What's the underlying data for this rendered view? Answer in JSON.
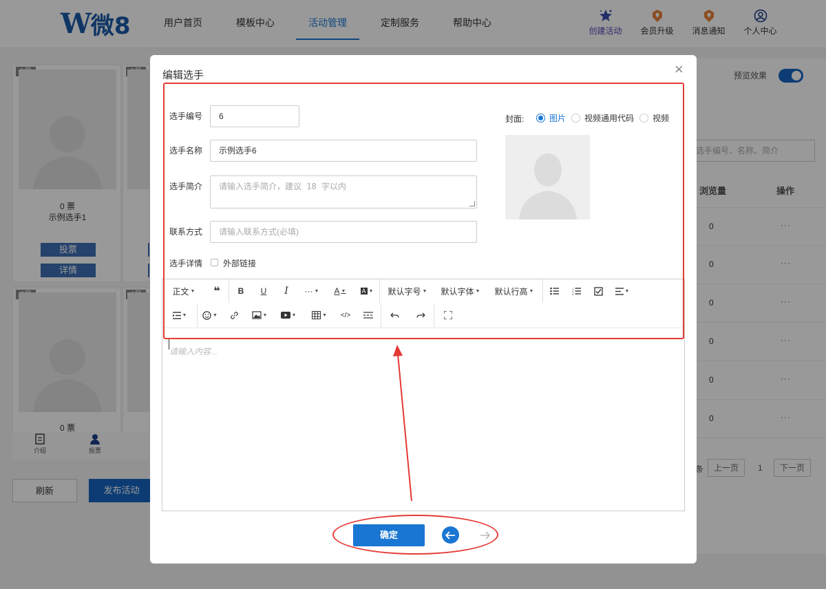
{
  "header": {
    "logo_mark": "W",
    "logo_text": "微8",
    "nav": [
      {
        "label": "用户首页"
      },
      {
        "label": "模板中心"
      },
      {
        "label": "活动管理"
      },
      {
        "label": "定制服务"
      },
      {
        "label": "帮助中心"
      }
    ],
    "actions": [
      {
        "label": "创建活动",
        "icon": "star-icon"
      },
      {
        "label": "会员升级",
        "icon": "badge-icon"
      },
      {
        "label": "消息通知",
        "icon": "bell-badge-icon"
      },
      {
        "label": "个人中心",
        "icon": "user-circle-icon"
      }
    ]
  },
  "background": {
    "cards": [
      {
        "num": "1号",
        "votes": "0 票",
        "name": "示例选手1",
        "vote_btn": "投票",
        "detail_btn": "详情"
      },
      {
        "num": "2号"
      },
      {
        "num": "3号",
        "votes": "0 票"
      },
      {
        "num": "4号"
      }
    ],
    "bottom_tabs": [
      {
        "label": "介绍",
        "icon": "doc-icon"
      },
      {
        "label": "投票",
        "icon": "person-icon"
      }
    ],
    "refresh_label": "刷新",
    "publish_label": "发布活动",
    "preview_label": "预览效果",
    "search_placeholder": "选手编号、名称、简介",
    "columns": {
      "views": "浏览量",
      "ops": "操作"
    },
    "rows": [
      {
        "views": "0",
        "ops": "···"
      },
      {
        "views": "0",
        "ops": "···"
      },
      {
        "views": "0",
        "ops": "···"
      },
      {
        "views": "0",
        "ops": "···"
      },
      {
        "views": "0",
        "ops": "···"
      },
      {
        "views": "0",
        "ops": "···"
      }
    ],
    "pager": {
      "total_tail": "条",
      "prev": "上一页",
      "page": "1",
      "next": "下一页"
    }
  },
  "modal": {
    "title": "编辑选手",
    "close": "×",
    "fields": {
      "number_label": "选手编号",
      "number_value": "6",
      "name_label": "选手名称",
      "name_value": "示例选手6",
      "intro_label": "选手简介",
      "intro_placeholder": "请输入选手简介，建议 18 字以内",
      "contact_label": "联系方式",
      "contact_placeholder": "请输入联系方式(必填)",
      "detail_label": "选手详情",
      "external_link_label": "外部链接"
    },
    "cover": {
      "label": "封面:",
      "options": [
        {
          "label": "图片",
          "selected": true
        },
        {
          "label": "视频通用代码",
          "selected": false
        },
        {
          "label": "视频",
          "selected": false
        }
      ]
    },
    "editor": {
      "toolbar_row1": [
        {
          "label": "正文",
          "dropdown": true,
          "icon": ""
        },
        {
          "label": "❝",
          "dropdown": false,
          "icon": "quote-icon"
        },
        {
          "label": "B",
          "dropdown": false,
          "icon": "bold-icon"
        },
        {
          "label": "U",
          "dropdown": false,
          "icon": "underline-icon"
        },
        {
          "label": "I",
          "dropdown": false,
          "icon": "italic-icon"
        },
        {
          "label": "···",
          "dropdown": true,
          "icon": "more-icon"
        },
        {
          "label": "A",
          "dropdown": true,
          "icon": "font-color-icon"
        },
        {
          "label": "A",
          "dropdown": true,
          "icon": "bg-color-icon"
        },
        {
          "label": "默认字号",
          "dropdown": true,
          "icon": ""
        },
        {
          "label": "默认字体",
          "dropdown": true,
          "icon": ""
        },
        {
          "label": "默认行高",
          "dropdown": true,
          "icon": ""
        },
        {
          "label": "",
          "dropdown": false,
          "icon": "bullet-list-icon"
        },
        {
          "label": "",
          "dropdown": false,
          "icon": "numbered-list-icon"
        },
        {
          "label": "",
          "dropdown": false,
          "icon": "todo-icon"
        },
        {
          "label": "",
          "dropdown": true,
          "icon": "align-icon"
        }
      ],
      "toolbar_row2": [
        {
          "label": "",
          "dropdown": true,
          "icon": "indent-icon"
        },
        {
          "label": "",
          "dropdown": true,
          "icon": "emoji-icon"
        },
        {
          "label": "",
          "dropdown": false,
          "icon": "link-icon"
        },
        {
          "label": "",
          "dropdown": true,
          "icon": "image-icon"
        },
        {
          "label": "",
          "dropdown": true,
          "icon": "video-icon"
        },
        {
          "label": "",
          "dropdown": true,
          "icon": "table-icon"
        },
        {
          "label": "",
          "dropdown": false,
          "icon": "code-icon"
        },
        {
          "label": "",
          "dropdown": false,
          "icon": "divider-icon"
        },
        {
          "label": "",
          "dropdown": false,
          "icon": "undo-icon"
        },
        {
          "label": "",
          "dropdown": false,
          "icon": "redo-icon"
        },
        {
          "label": "",
          "dropdown": false,
          "icon": "fullscreen-icon"
        }
      ],
      "placeholder": "请输入内容..."
    },
    "confirm_label": "确定"
  },
  "colors": {
    "accent": "#1976d2",
    "annotation": "#e53935"
  }
}
